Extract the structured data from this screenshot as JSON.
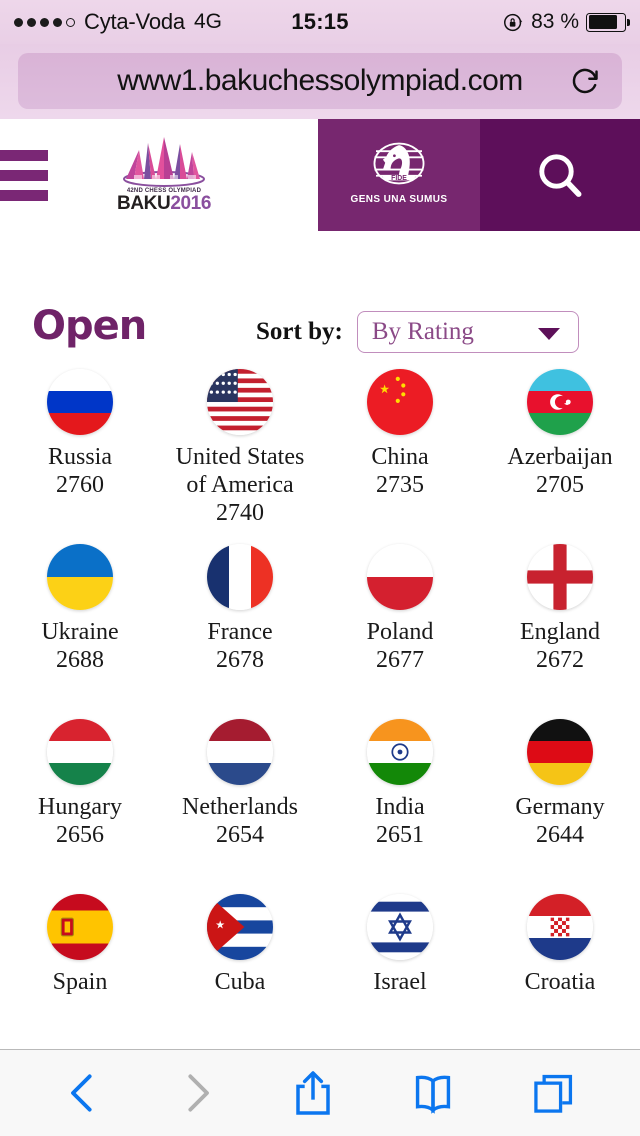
{
  "statusbar": {
    "carrier": "Cyta-Voda",
    "network": "4G",
    "time": "15:15",
    "battery_percent": "83 %",
    "signal_dots_filled": 4,
    "signal_dots_total": 5,
    "lock_icon": "rotation-lock-icon",
    "battery_icon": "battery-icon"
  },
  "browser": {
    "url": "www1.bakuchessolympiad.com",
    "reload_icon": "reload-icon",
    "toolbar": {
      "back_label": "back-icon",
      "forward_label": "forward-icon",
      "share_label": "share-icon",
      "bookmarks_label": "bookmarks-icon",
      "tabs_label": "tabs-icon",
      "back_enabled": true,
      "forward_enabled": false,
      "accent_color": "#0b76ef",
      "disabled_color": "#b0b0b0"
    }
  },
  "site_header": {
    "menu_icon": "hamburger-menu-icon",
    "logo": {
      "subtitle": "42ND CHESS OLYMPIAD",
      "name": "BAKU",
      "year": "2016"
    },
    "fide": {
      "wordmark": "FIDE",
      "motto": "GENS UNA SUMUS"
    },
    "search_icon": "search-icon",
    "panel_color": "#77276f",
    "search_panel_color": "#5d0f5a"
  },
  "page": {
    "title": "Open",
    "title_color": "#6f2368",
    "sort_label": "Sort by:",
    "sort_value": "By Rating",
    "sort_caret_icon": "chevron-down-icon"
  },
  "teams": [
    {
      "name": "Russia",
      "rating": "2760",
      "flag": "russia-flag-icon"
    },
    {
      "name": "United States of America",
      "rating": "2740",
      "flag": "united-states-flag-icon"
    },
    {
      "name": "China",
      "rating": "2735",
      "flag": "china-flag-icon"
    },
    {
      "name": "Azerbaijan",
      "rating": "2705",
      "flag": "azerbaijan-flag-icon"
    },
    {
      "name": "Ukraine",
      "rating": "2688",
      "flag": "ukraine-flag-icon"
    },
    {
      "name": "France",
      "rating": "2678",
      "flag": "france-flag-icon"
    },
    {
      "name": "Poland",
      "rating": "2677",
      "flag": "poland-flag-icon"
    },
    {
      "name": "England",
      "rating": "2672",
      "flag": "england-flag-icon"
    },
    {
      "name": "Hungary",
      "rating": "2656",
      "flag": "hungary-flag-icon"
    },
    {
      "name": "Netherlands",
      "rating": "2654",
      "flag": "netherlands-flag-icon"
    },
    {
      "name": "India",
      "rating": "2651",
      "flag": "india-flag-icon"
    },
    {
      "name": "Germany",
      "rating": "2644",
      "flag": "germany-flag-icon"
    },
    {
      "name": "Spain",
      "rating": "",
      "flag": "spain-flag-icon"
    },
    {
      "name": "Cuba",
      "rating": "",
      "flag": "cuba-flag-icon"
    },
    {
      "name": "Israel",
      "rating": "",
      "flag": "israel-flag-icon"
    },
    {
      "name": "Croatia",
      "rating": "",
      "flag": "croatia-flag-icon"
    }
  ]
}
